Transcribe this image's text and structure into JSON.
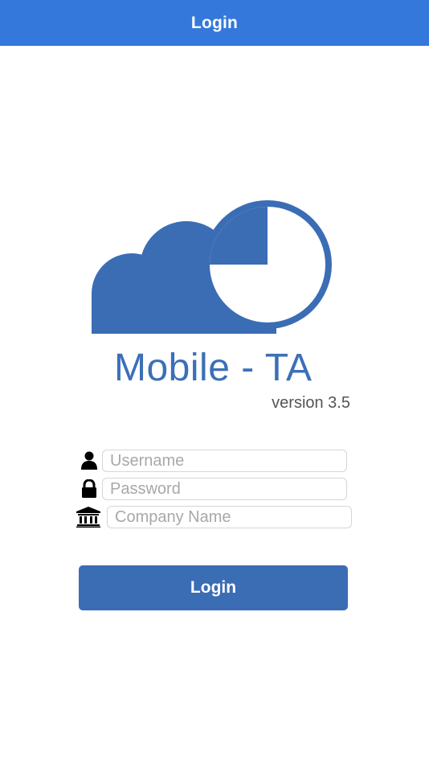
{
  "nav": {
    "title": "Login"
  },
  "branding": {
    "app_name": "Mobile - TA",
    "version": "version 3.5",
    "logo_icon": "cloud-clock-logo",
    "logo_color": "#3b6db5"
  },
  "form": {
    "username": {
      "icon": "user-icon",
      "value": "",
      "placeholder": "Username"
    },
    "password": {
      "icon": "lock-icon",
      "value": "",
      "placeholder": "Password"
    },
    "company": {
      "icon": "bank-icon",
      "value": "",
      "placeholder": "Company Name"
    }
  },
  "login_button": {
    "label": "Login"
  },
  "colors": {
    "nav_bar": "#3478dc",
    "button": "#3b6db5",
    "brand_text": "#3c6fb8"
  }
}
